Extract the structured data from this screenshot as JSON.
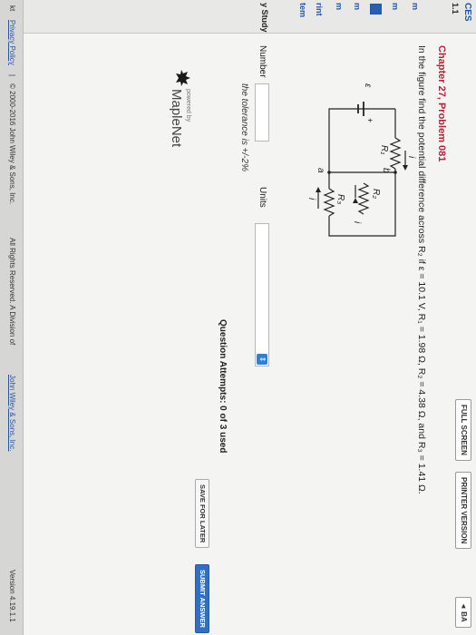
{
  "nav": {
    "title": "CES",
    "number": "1.1",
    "study": "y Study",
    "items": [
      "m",
      "m",
      "m",
      "m",
      "rint",
      "tem"
    ]
  },
  "toolbar": {
    "full_screen": "FULL SCREEN",
    "printer_version": "PRINTER VERSION",
    "back": "◄ BA"
  },
  "problem": {
    "title": "Chapter 27, Problem 081",
    "prompt": "In the figure find the potential difference across R₂ if ε = 10.1 V, R₁ = 1.98 Ω, R₂ = 4.38 Ω, and R₃ = 1.41 Ω."
  },
  "figure": {
    "labels": {
      "emf": "ε",
      "plus": "+",
      "b": "b",
      "a": "a",
      "r1": "R₁",
      "r2": "R₂",
      "r3": "R₃",
      "i_top": "i",
      "i_mid": "i",
      "i_bottom": "i"
    }
  },
  "answer": {
    "number_label": "Number",
    "number_value": "",
    "units_label": "Units",
    "units_value": "",
    "tolerance": "the tolerance is +/-2%"
  },
  "status": {
    "attempts": "Question Attempts: 0 of 3 used"
  },
  "actions": {
    "save_label": "SAVE FOR LATER",
    "submit_label": "SUBMIT ANSWER"
  },
  "brand": {
    "powered_by": "powered by",
    "name": "MapleNet"
  },
  "footer": {
    "left": "kt",
    "privacy": "Privacy Policy",
    "separator": "|",
    "copyright": "© 2000-2016 John Wiley & Sons, Inc.",
    "rights": "All Rights Reserved. A Division of",
    "company_link": "John Wiley & Sons, Inc.",
    "version": "Version 4.19.1.1"
  },
  "colors": {
    "title_red": "#b3223a",
    "submit_blue": "#2f6fc4",
    "link_blue": "#2a55a0"
  }
}
